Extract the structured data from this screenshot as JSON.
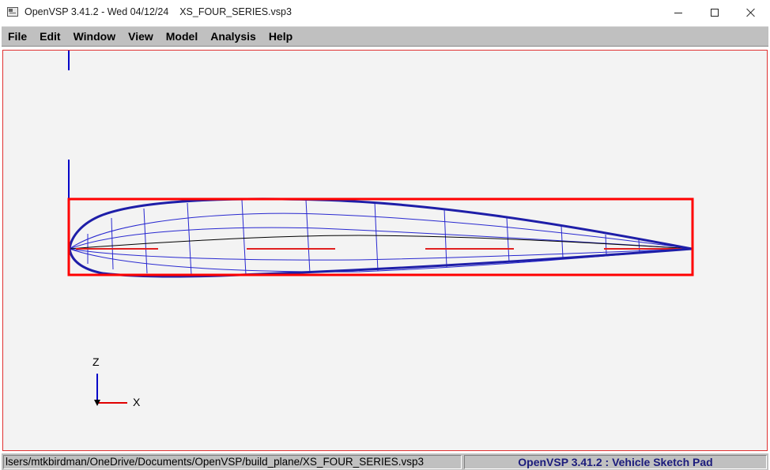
{
  "window": {
    "title": "OpenVSP 3.41.2 - Wed 04/12/24    XS_FOUR_SERIES.vsp3",
    "controls": {
      "minimize": "minimize",
      "maximize": "maximize",
      "close": "close"
    }
  },
  "menu": {
    "items": [
      "File",
      "Edit",
      "Window",
      "View",
      "Model",
      "Analysis",
      "Help"
    ]
  },
  "viewport": {
    "axis_labels": {
      "z": "Z",
      "x": "X"
    },
    "colors": {
      "airfoil_outline": "#1e1ea8",
      "wireframe": "#2828d0",
      "camber_line": "#000000",
      "highlight_box": "#ff0000",
      "highlight_segments": "#e02020",
      "axis_z": "#0000c8",
      "axis_x": "#e00000",
      "background": "#f3f3f3"
    }
  },
  "status": {
    "file_path": "lsers/mtkbirdman/OneDrive/Documents/OpenVSP/build_plane/XS_FOUR_SERIES.vsp3",
    "app_name": "OpenVSP 3.41.2 : Vehicle Sketch Pad"
  },
  "icons": {
    "app": "openvsp-app-icon",
    "minimize": "minimize-icon",
    "maximize": "maximize-icon",
    "close": "close-icon"
  }
}
